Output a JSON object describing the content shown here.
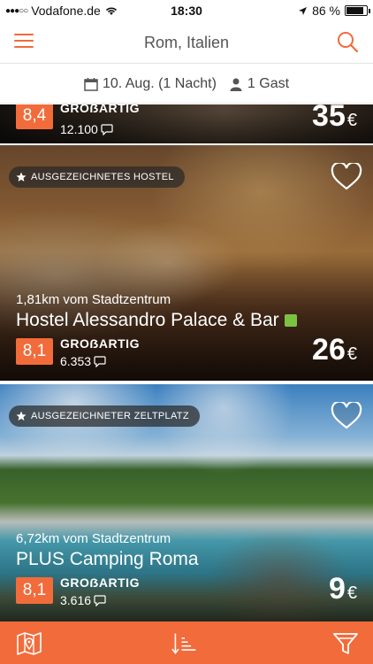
{
  "status": {
    "carrier": "Vodafone.de",
    "time": "18:30",
    "battery": "86 %",
    "battery_level": 0.86
  },
  "nav": {
    "title": "Rom, Italien",
    "menu_icon": "hamburger-menu-icon",
    "search_icon": "search-icon"
  },
  "filters": {
    "date": "10. Aug. (1 Nacht)",
    "guests": "1 Gast"
  },
  "colors": {
    "accent": "#f26b3a",
    "eco": "#7cc242"
  },
  "listings": [
    {
      "rating_label": "GROẞARTIG",
      "score": "8,4",
      "reviews": "12.100",
      "price": "35",
      "currency": "€"
    },
    {
      "badge": "AUSGEZEICHNETES HOSTEL",
      "distance": "1,81km vom Stadtzentrum",
      "name": "Hostel Alessandro Palace & Bar",
      "score": "8,1",
      "rating_label": "GROẞARTIG",
      "reviews": "6.353",
      "price": "26",
      "currency": "€"
    },
    {
      "badge": "AUSGEZEICHNETER ZELTPLATZ",
      "distance": "6,72km vom Stadtzentrum",
      "name": "PLUS Camping Roma",
      "score": "8,1",
      "rating_label": "GROẞARTIG",
      "reviews": "3.616",
      "price": "9",
      "currency": "€"
    }
  ],
  "bottom": {
    "map_icon": "map-icon",
    "sort_icon": "sort-icon",
    "filter_icon": "filter-icon"
  }
}
